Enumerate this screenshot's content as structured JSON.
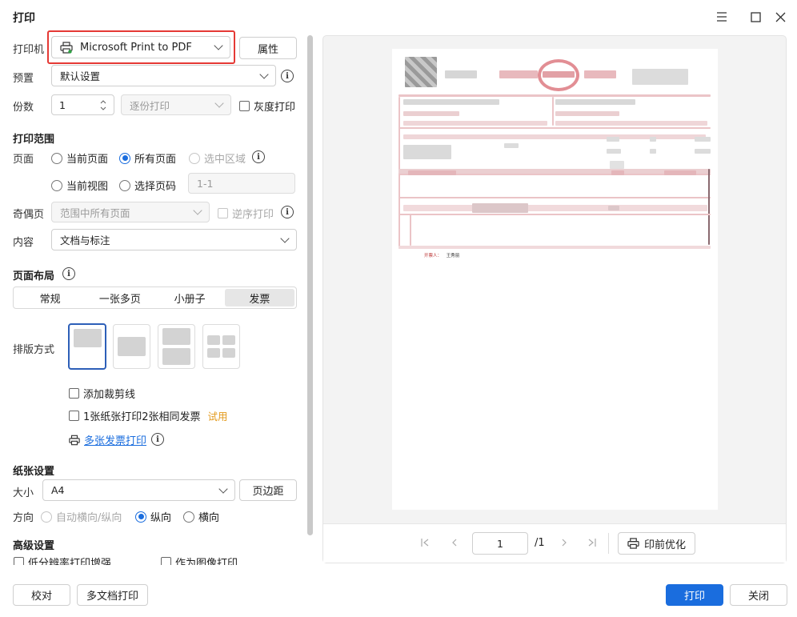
{
  "window": {
    "title": "打印"
  },
  "printer": {
    "label": "打印机",
    "value": "Microsoft Print to PDF",
    "properties_button": "属性"
  },
  "preset": {
    "label": "预置",
    "value": "默认设置"
  },
  "copies": {
    "label": "份数",
    "value": "1",
    "collate": "逐份打印",
    "grayscale": "灰度打印"
  },
  "print_range": {
    "title": "打印范围",
    "pages_label": "页面",
    "current_page": "当前页面",
    "all_pages": "所有页面",
    "selection": "选中区域",
    "current_view": "当前视图",
    "select_pages": "选择页码",
    "pages_placeholder": "1-1",
    "odd_even_label": "奇偶页",
    "odd_even_value": "范围中所有页面",
    "reverse": "逆序打印",
    "content_label": "内容",
    "content_value": "文档与标注"
  },
  "page_layout": {
    "title": "页面布局",
    "tabs": [
      "常规",
      "一张多页",
      "小册子",
      "发票"
    ],
    "active_tab": "发票",
    "arrangement_label": "排版方式",
    "add_crop_marks": "添加裁剪线",
    "two_same_invoices": "1张纸张打印2张相同发票",
    "trial_badge": "试用",
    "multi_invoice_link": "多张发票打印"
  },
  "paper": {
    "title": "纸张设置",
    "size_label": "大小",
    "size_value": "A4",
    "margins_button": "页边距",
    "orientation_label": "方向",
    "auto_orientation": "自动横向/纵向",
    "portrait": "纵向",
    "landscape": "横向"
  },
  "advanced": {
    "title": "高级设置",
    "low_res": "低分辨率打印增强",
    "as_image": "作为图像打印"
  },
  "preview": {
    "page_input": "1",
    "page_total": "/1",
    "optimize_button": "印前优化",
    "stamp_text": "开票人：",
    "stamp_name": "王秀丽"
  },
  "footer": {
    "proofread": "校对",
    "multi_doc": "多文档打印",
    "print": "打印",
    "close": "关闭"
  },
  "colors": {
    "accent": "#1a6dde",
    "highlight": "#e53935",
    "trial": "#e39a1c"
  }
}
